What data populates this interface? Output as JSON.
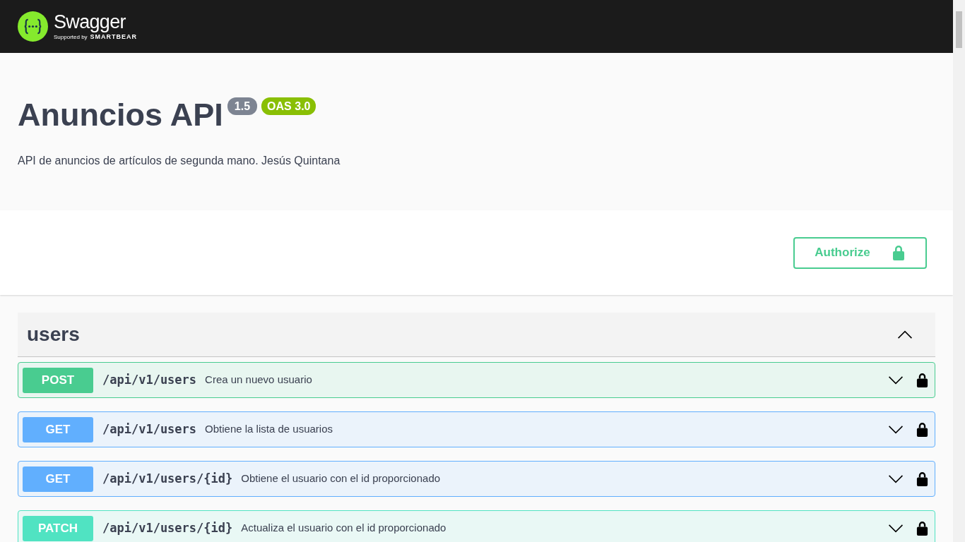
{
  "topbar": {
    "brand": "Swagger",
    "tagline_prefix": "Supported by",
    "tagline_brand": "SMARTBEAR"
  },
  "info": {
    "title": "Anuncios API",
    "version": "1.5",
    "oas": "OAS 3.0",
    "description": "API de anuncios de artículos de segunda mano. Jesús Quintana"
  },
  "authorize_button": "Authorize",
  "tag": {
    "name": "users",
    "expanded": true
  },
  "operations": [
    {
      "kind": "post",
      "method": "POST",
      "path": "/api/v1/users",
      "summary": "Crea un nuevo usuario"
    },
    {
      "kind": "get",
      "method": "GET",
      "path": "/api/v1/users",
      "summary": "Obtiene la lista de usuarios"
    },
    {
      "kind": "get",
      "method": "GET",
      "path": "/api/v1/users/{id}",
      "summary": "Obtiene el usuario con el id proporcionado"
    },
    {
      "kind": "patch",
      "method": "PATCH",
      "path": "/api/v1/users/{id}",
      "summary": "Actualiza el usuario con el id proporcionado"
    }
  ]
}
